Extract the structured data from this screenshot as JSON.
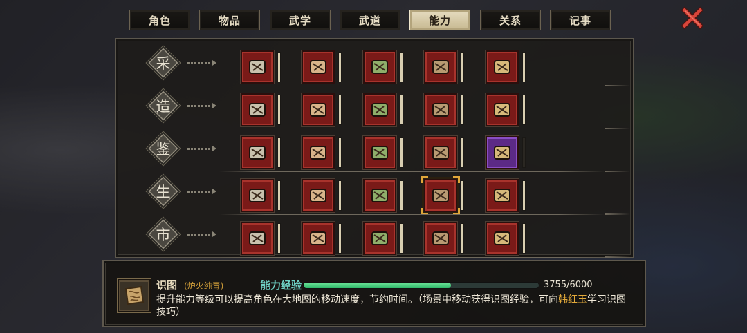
{
  "tabs": [
    {
      "label": "角色",
      "active": false
    },
    {
      "label": "物品",
      "active": false
    },
    {
      "label": "武学",
      "active": false
    },
    {
      "label": "武道",
      "active": false
    },
    {
      "label": "能力",
      "active": true
    },
    {
      "label": "关系",
      "active": false
    },
    {
      "label": "记事",
      "active": false
    }
  ],
  "close_icon": "close-x-icon",
  "categories": [
    {
      "char": "采",
      "skills": [
        {
          "icon": "pickaxe-ore-icon",
          "level": 1.0
        },
        {
          "icon": "axe-wood-icon",
          "level": 1.0
        },
        {
          "icon": "herb-basket-icon",
          "level": 1.0
        },
        {
          "icon": "fishing-rod-icon",
          "level": 1.0
        },
        {
          "icon": "silk-thread-icon",
          "level": 1.0
        }
      ]
    },
    {
      "char": "造",
      "skills": [
        {
          "icon": "anvil-icon",
          "level": 1.0
        },
        {
          "icon": "armor-tailoring-icon",
          "level": 1.0
        },
        {
          "icon": "cooking-icon",
          "level": 1.0
        },
        {
          "icon": "alchemy-icon",
          "level": 1.0
        },
        {
          "icon": "gem-crafting-icon",
          "level": 1.0
        }
      ]
    },
    {
      "char": "鉴",
      "skills": [
        {
          "icon": "appraise-scroll-icon",
          "level": 1.0
        },
        {
          "icon": "appraise-book-icon",
          "level": 1.0
        },
        {
          "icon": "appraise-tool-icon",
          "level": 1.0
        },
        {
          "icon": "appraise-jade-icon",
          "level": 1.0
        },
        {
          "icon": "appraise-treasure-icon",
          "level": 0.0,
          "rarity": "purple"
        }
      ]
    },
    {
      "char": "生",
      "skills": [
        {
          "icon": "mouth-food-icon",
          "level": 1.0
        },
        {
          "icon": "abacus-icon",
          "level": 1.0
        },
        {
          "icon": "lodging-bowl-icon",
          "level": 1.0
        },
        {
          "icon": "map-reading-icon",
          "level": 1.0,
          "selected": true
        },
        {
          "icon": "whip-riding-icon",
          "level": 1.0
        }
      ]
    },
    {
      "char": "市",
      "skills": [
        {
          "icon": "money-bag-icon",
          "level": 1.0
        },
        {
          "icon": "bargain-hand-icon",
          "level": 1.0
        },
        {
          "icon": "tea-icon",
          "level": 1.0
        },
        {
          "icon": "stamp-gear-icon",
          "level": 1.0
        },
        {
          "icon": "horn-icon",
          "level": 1.0
        }
      ]
    }
  ],
  "info": {
    "icon": "map-reading-icon",
    "title": "识图",
    "subtitle": "(炉火纯青)",
    "xp_label": "能力经验",
    "xp_current": 3755,
    "xp_max": 6000,
    "xp_text": "3755/6000",
    "desc_part1": "提升能力等级可以提高角色在大地图的移动速度，节约时间。（场景中移动获得识图经验，可向",
    "desc_highlight": "韩红玉",
    "desc_part2": "学习识图技巧）"
  },
  "colors": {
    "accent_gold": "#e2a93a",
    "xp_label": "#6fd1c5",
    "xp_fill": "#3ec97c",
    "skill_bg": "#7a1a18",
    "skill_rare_bg": "#5c2a86"
  }
}
